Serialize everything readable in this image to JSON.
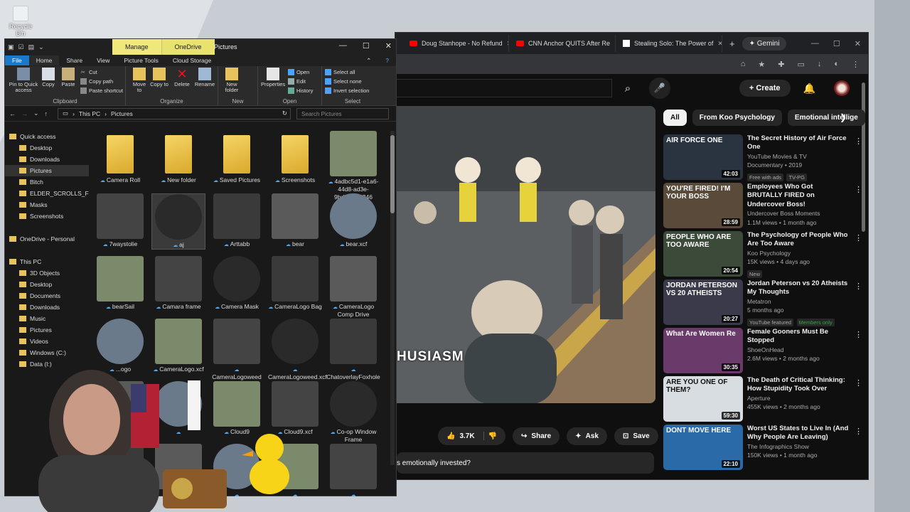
{
  "desktop": {
    "recycle_bin_label": "Recycle Bin"
  },
  "browser": {
    "tabs": [
      {
        "label": "Doug Stanhope - No Refund"
      },
      {
        "label": "CNN Anchor QUITS After Re"
      },
      {
        "label": "Stealing Solo: The Power of"
      }
    ],
    "gemini_label": "Gemini",
    "new_tab": "+",
    "create_label": "Create",
    "video": {
      "subtitle": "HUSIASM",
      "like_count": "3.7K",
      "share_label": "Share",
      "ask_label": "Ask",
      "save_label": "Save",
      "description_snippet": "s emotionally invested?"
    },
    "chips": [
      "All",
      "From Koo Psychology",
      "Emotional intellige"
    ],
    "recommendations": [
      {
        "title": "The Secret History of Air Force One",
        "channel": "YouTube Movies & TV",
        "views": "Documentary • 2019",
        "badges": [
          "Free with ads",
          "TV-PG"
        ],
        "duration": "42:03",
        "thumb_text": "AIR FORCE ONE",
        "thumb_color": "#2a3340"
      },
      {
        "title": "Employees Who Got BRUTALLY FIRED on Undercover Boss!",
        "channel": "Undercover Boss Moments",
        "views": "1.1M views • 1 month ago",
        "badges": [],
        "duration": "28:59",
        "thumb_text": "YOU'RE FIRED! I'M YOUR BOSS",
        "thumb_color": "#5a4a3a"
      },
      {
        "title": "The Psychology of People Who Are Too Aware",
        "channel": "Koo Psychology",
        "views": "15K views • 4 days ago",
        "badges": [
          "New"
        ],
        "duration": "20:54",
        "thumb_text": "PEOPLE WHO ARE TOO AWARE",
        "thumb_color": "#3c4a3a"
      },
      {
        "title": "Jordan Peterson vs 20 Atheists My Thoughts",
        "channel": "Metatron",
        "views": "5 months ago",
        "badges": [
          "YouTube featured",
          "Members only"
        ],
        "duration": "20:27",
        "thumb_text": "JORDAN PETERSON VS 20 ATHEISTS",
        "thumb_color": "#3a3a4a"
      },
      {
        "title": "Female Gooners Must Be Stopped",
        "channel": "ShoeOnHead",
        "views": "2.6M views • 2 months ago",
        "badges": [],
        "duration": "30:35",
        "thumb_text": "What Are Women Re",
        "thumb_color": "#6a3a6a"
      },
      {
        "title": "The Death of Critical Thinking: How Stupidity Took Over",
        "channel": "Aperture",
        "views": "455K views • 2 months ago",
        "badges": [],
        "duration": "59:30",
        "thumb_text": "ARE YOU ONE OF THEM?",
        "thumb_color": "#d8dde2"
      },
      {
        "title": "Worst US States to Live In (And Why People Are Leaving)",
        "channel": "The Infographics Show",
        "views": "150K views • 1 month ago",
        "badges": [],
        "duration": "22:10",
        "thumb_text": "DONT MOVE HERE",
        "thumb_color": "#2a6aa8"
      }
    ]
  },
  "explorer": {
    "context_tabs": [
      "Manage",
      "OneDrive"
    ],
    "window_title": "Pictures",
    "ribbon_tabs": [
      "File",
      "Home",
      "Share",
      "View",
      "Picture Tools",
      "Cloud Storage"
    ],
    "ribbon": {
      "pin_label": "Pin to Quick access",
      "copy_label": "Copy",
      "paste_label": "Paste",
      "cut_label": "Cut",
      "copy_path_label": "Copy path",
      "paste_shortcut_label": "Paste shortcut",
      "clipboard_group": "Clipboard",
      "move_label": "Move to",
      "copy_to_label": "Copy to",
      "delete_label": "Delete",
      "rename_label": "Rename",
      "organize_group": "Organize",
      "new_folder_label": "New folder",
      "new_group": "New",
      "properties_label": "Properties",
      "open_label": "Open",
      "edit_label": "Edit",
      "history_label": "History",
      "open_group": "Open",
      "select_all_label": "Select all",
      "select_none_label": "Select none",
      "invert_label": "Invert selection",
      "select_group": "Select"
    },
    "address": [
      "This PC",
      "Pictures"
    ],
    "search_placeholder": "Search Pictures",
    "nav": [
      {
        "label": "Quick access",
        "indent": 0
      },
      {
        "label": "Desktop",
        "indent": 1
      },
      {
        "label": "Downloads",
        "indent": 1
      },
      {
        "label": "Pictures",
        "indent": 1,
        "selected": true
      },
      {
        "label": "Bitch",
        "indent": 1
      },
      {
        "label": "ELDER_SCROLLS_FREE_",
        "indent": 1
      },
      {
        "label": "Masks",
        "indent": 1
      },
      {
        "label": "Screenshots",
        "indent": 1
      },
      {
        "label": "",
        "indent": 0
      },
      {
        "label": "OneDrive - Personal",
        "indent": 0
      },
      {
        "label": "",
        "indent": 0
      },
      {
        "label": "This PC",
        "indent": 0
      },
      {
        "label": "3D Objects",
        "indent": 1
      },
      {
        "label": "Desktop",
        "indent": 1
      },
      {
        "label": "Documents",
        "indent": 1
      },
      {
        "label": "Downloads",
        "indent": 1
      },
      {
        "label": "Music",
        "indent": 1
      },
      {
        "label": "Pictures",
        "indent": 1
      },
      {
        "label": "Videos",
        "indent": 1
      },
      {
        "label": "Windows (C:)",
        "indent": 1
      },
      {
        "label": "Data (I:)",
        "indent": 1
      }
    ],
    "files": [
      {
        "name": "Camera Roll",
        "kind": "folder"
      },
      {
        "name": "New folder",
        "kind": "folder"
      },
      {
        "name": "Saved Pictures",
        "kind": "folder"
      },
      {
        "name": "Screenshots",
        "kind": "folder"
      },
      {
        "name": "4adbc5d1-e1a6-44d8-ad3e-9bdc167fb246",
        "kind": "image"
      },
      {
        "name": "7waystolie",
        "kind": "image"
      },
      {
        "name": "aj",
        "kind": "image",
        "selected": true
      },
      {
        "name": "Arttabb",
        "kind": "image"
      },
      {
        "name": "bear",
        "kind": "image"
      },
      {
        "name": "bear.xcf",
        "kind": "image"
      },
      {
        "name": "bearSail",
        "kind": "image"
      },
      {
        "name": "Camara frame",
        "kind": "image"
      },
      {
        "name": "Camera Mask",
        "kind": "image"
      },
      {
        "name": "CameraLogo Bag",
        "kind": "image"
      },
      {
        "name": "CameraLogo Comp Drive",
        "kind": "image"
      },
      {
        "name": "...ogo",
        "kind": "image"
      },
      {
        "name": "CameraLogo.xcf",
        "kind": "image"
      },
      {
        "name": "CameraLogoweed",
        "kind": "image"
      },
      {
        "name": "CameraLogoweed.xcf",
        "kind": "image"
      },
      {
        "name": "ChatoverlayFoxhole",
        "kind": "image"
      },
      {
        "name": "",
        "kind": "image"
      },
      {
        "name": "",
        "kind": "image"
      },
      {
        "name": "Cloud9",
        "kind": "image"
      },
      {
        "name": "Cloud9.xcf",
        "kind": "image"
      },
      {
        "name": "Co-op Window Frame",
        "kind": "image"
      },
      {
        "name": "",
        "kind": "image"
      },
      {
        "name": "",
        "kind": "image"
      },
      {
        "name": "",
        "kind": "image"
      },
      {
        "name": "",
        "kind": "image"
      },
      {
        "name": "",
        "kind": "image"
      }
    ]
  }
}
